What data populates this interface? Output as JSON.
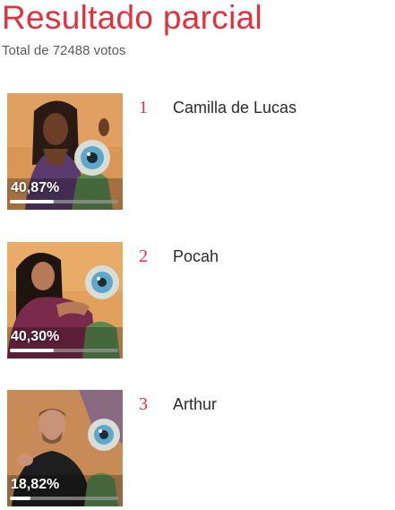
{
  "header": {
    "title": "Resultado parcial",
    "total_label": "Total de 72488 votos"
  },
  "candidates": [
    {
      "rank": "1",
      "name": "Camilla de Lucas",
      "percent_label": "40,87%",
      "percent_value": 40.87,
      "photo_bg": "#d99655",
      "photo_icon": "big-brother-eye-mascot"
    },
    {
      "rank": "2",
      "name": "Pocah",
      "percent_label": "40,30%",
      "percent_value": 40.3,
      "photo_bg": "#e1a15c",
      "photo_icon": "big-brother-eye-mascot"
    },
    {
      "rank": "3",
      "name": "Arthur",
      "percent_label": "18,82%",
      "percent_value": 18.82,
      "photo_bg": "#c88b58",
      "photo_icon": "big-brother-eye-mascot"
    }
  ],
  "colors": {
    "accent": "#e3303c",
    "bar_fill": "#ffffff",
    "bar_track": "#969696"
  }
}
